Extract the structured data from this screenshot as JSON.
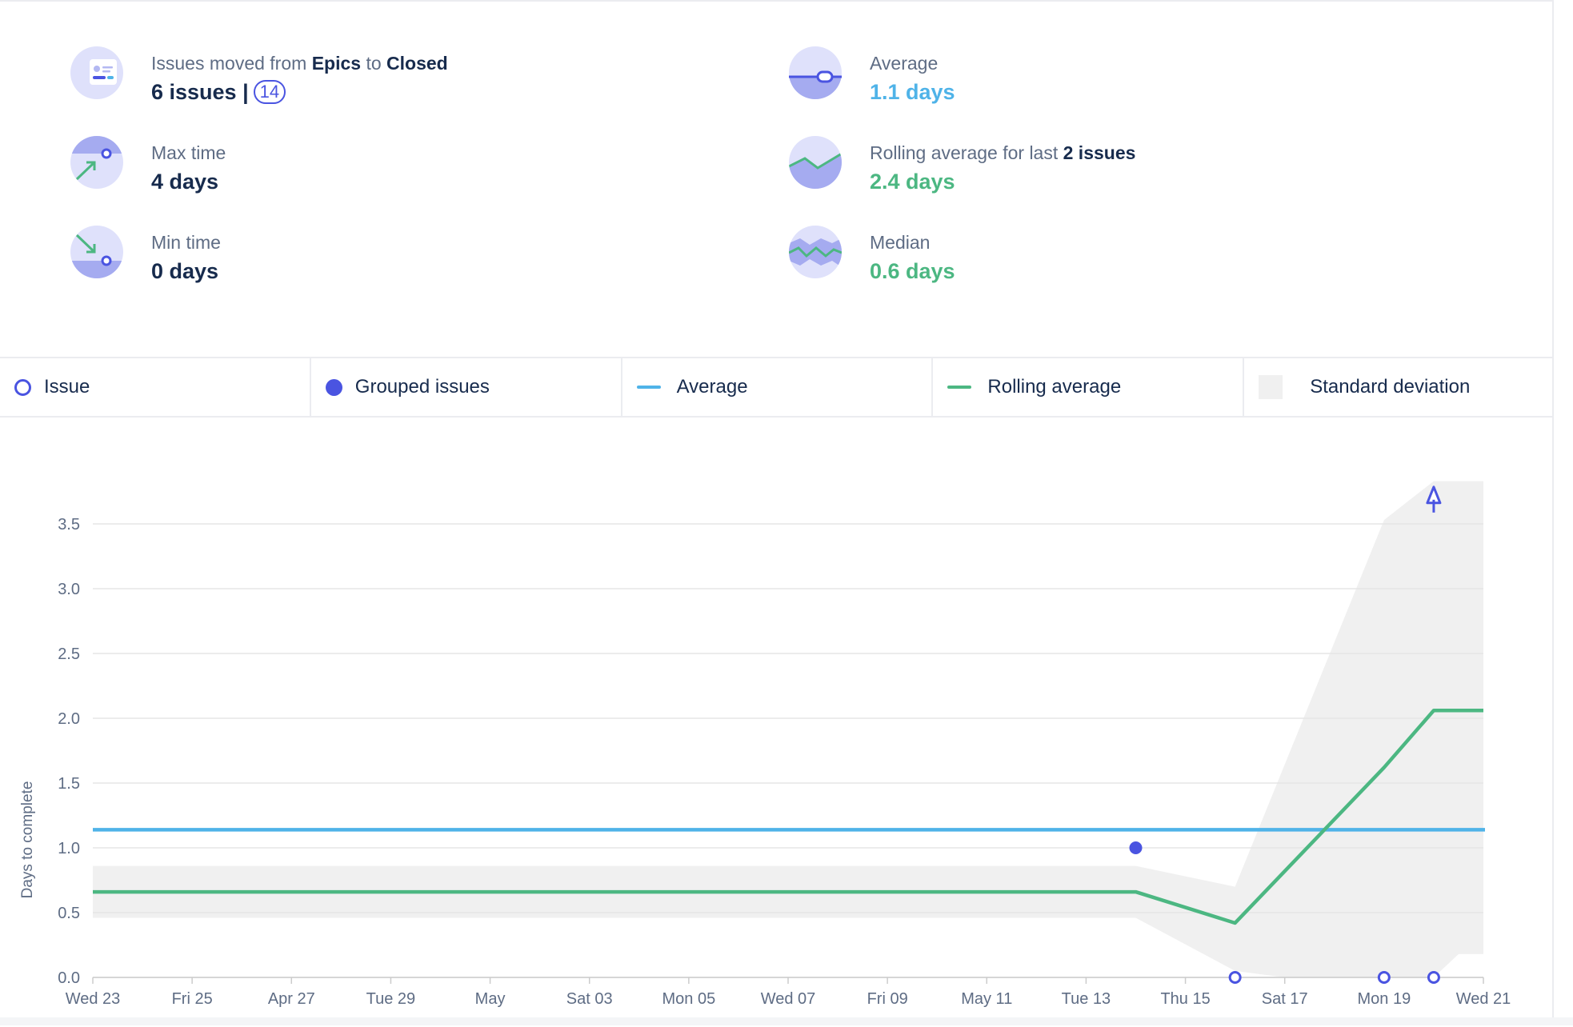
{
  "stats": {
    "moved": {
      "prefix": "Issues moved from",
      "from": "Epics",
      "connector": "to",
      "to": "Closed",
      "value": "6 issues |",
      "badge": "14"
    },
    "max_time": {
      "label": "Max time",
      "value": "4 days"
    },
    "min_time": {
      "label": "Min time",
      "value": "0 days"
    },
    "average": {
      "label": "Average",
      "value": "1.1 days"
    },
    "rolling": {
      "label_prefix": "Rolling average for last",
      "label_bold": "2 issues",
      "value": "2.4 days"
    },
    "median": {
      "label": "Median",
      "value": "0.6 days"
    }
  },
  "legend": {
    "issue": "Issue",
    "grouped": "Grouped issues",
    "average": "Average",
    "rolling": "Rolling average",
    "stddev": "Standard deviation"
  },
  "colors": {
    "issue": "#4a54e1",
    "average": "#4fb3e8",
    "rolling": "#4cb782",
    "stddev": "#f0f0f0",
    "grid": "#e6e6e6",
    "text_muted": "#5e6c84"
  },
  "icons": {
    "moved": "issue-card-icon",
    "average": "average-slider-icon",
    "max_time": "arrow-up-right-icon",
    "rolling": "rolling-line-icon",
    "min_time": "arrow-down-right-icon",
    "median": "median-wave-icon"
  },
  "chart_data": {
    "type": "scatter",
    "ylabel": "Days to complete",
    "ylim": [
      0,
      3.85
    ],
    "yticks": [
      "0.0",
      "0.5",
      "1.0",
      "1.5",
      "2.0",
      "2.5",
      "3.0",
      "3.5"
    ],
    "xlim": [
      "2023-04-23",
      "2023-06-21"
    ],
    "xticks": [
      {
        "date": "2023-04-23",
        "label": "Wed 23"
      },
      {
        "date": "2023-04-25",
        "label": "Fri 25"
      },
      {
        "date": "2023-04-27",
        "label": "Apr 27"
      },
      {
        "date": "2023-04-29",
        "label": "Tue 29"
      },
      {
        "date": "2023-05-01",
        "label": "May"
      },
      {
        "date": "2023-05-03",
        "label": "Sat 03"
      },
      {
        "date": "2023-05-05",
        "label": "Mon 05"
      },
      {
        "date": "2023-05-07",
        "label": "Wed 07"
      },
      {
        "date": "2023-05-09",
        "label": "Fri 09"
      },
      {
        "date": "2023-05-11",
        "label": "May 11"
      },
      {
        "date": "2023-05-13",
        "label": "Tue 13"
      },
      {
        "date": "2023-05-15",
        "label": "Thu 15"
      },
      {
        "date": "2023-05-17",
        "label": "Sat 17"
      },
      {
        "date": "2023-05-19",
        "label": "Mon 19"
      },
      {
        "date": "2023-05-21",
        "label": "Wed 21"
      }
    ],
    "issues": [
      {
        "date": "2023-05-16",
        "y": 0
      },
      {
        "date": "2023-05-19",
        "y": 0
      },
      {
        "date": "2023-05-20",
        "y": 0
      }
    ],
    "grouped_issues": [
      {
        "date": "2023-05-14",
        "y": 1.0
      }
    ],
    "offscale_issue": {
      "date": "2023-05-20",
      "y": 4
    },
    "average": 1.14,
    "rolling_average": [
      {
        "date": "2023-04-23",
        "y": 0.66
      },
      {
        "date": "2023-05-14",
        "y": 0.66
      },
      {
        "date": "2023-05-16",
        "y": 0.42
      },
      {
        "date": "2023-05-19",
        "y": 1.62
      },
      {
        "date": "2023-05-20",
        "y": 2.06
      },
      {
        "date": "2023-05-21",
        "y": 2.06
      }
    ],
    "std_upper": [
      {
        "date": "2023-04-23",
        "y": 0.86
      },
      {
        "date": "2023-05-14",
        "y": 0.86
      },
      {
        "date": "2023-05-16",
        "y": 0.7
      },
      {
        "date": "2023-05-19",
        "y": 3.53
      },
      {
        "date": "2023-05-20",
        "y": 3.83
      },
      {
        "date": "2023-05-21",
        "y": 3.83
      }
    ],
    "std_lower": [
      {
        "date": "2023-04-23",
        "y": 0.46
      },
      {
        "date": "2023-05-14",
        "y": 0.46
      },
      {
        "date": "2023-05-16",
        "y": 0.05
      },
      {
        "date": "2023-05-17",
        "y": 0
      },
      {
        "date": "2023-05-20",
        "y": 0
      },
      {
        "date": "2023-05-20.5",
        "y": 0.18
      },
      {
        "date": "2023-05-21",
        "y": 0.18
      }
    ],
    "grid": true,
    "legend_position": "top"
  }
}
